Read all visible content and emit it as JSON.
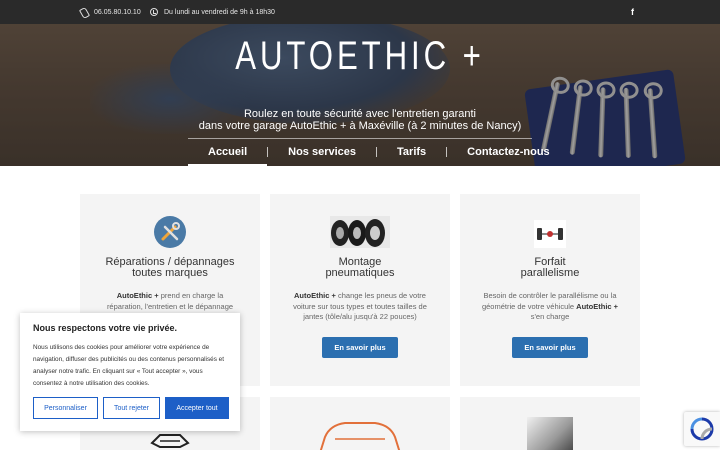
{
  "topbar": {
    "phone": "06.05.80.10.10",
    "hours": "Du lundi au vendredi de 9h à 18h30",
    "facebook": "f"
  },
  "hero": {
    "title": "AUTOETHIC +",
    "subtitle_line1": "Roulez en toute sécurité avec l'entretien garanti",
    "subtitle_line2": "dans votre garage AutoEthic + à Maxéville (à 2 minutes de Nancy)"
  },
  "nav": [
    {
      "label": "Accueil",
      "active": true
    },
    {
      "label": "Nos services"
    },
    {
      "label": "Tarifs"
    },
    {
      "label": "Contactez-nous"
    }
  ],
  "cards": [
    {
      "title_line1": "Réparations / dépannages",
      "title_line2": "toutes marques",
      "brand": "AutoEthic +",
      "desc_after": " prend en charge la réparation, l'entretien et le dépannage",
      "icon": "tools-icon"
    },
    {
      "title_line1": "Montage",
      "title_line2": "pneumatiques",
      "brand": "AutoEthic +",
      "desc_after": " change les pneus de votre voiture sur tous types et toutes tailles de jantes (tôle/alu jusqu'à 22 pouces)",
      "button": "En savoir plus",
      "icon": "tires-icon"
    },
    {
      "title_line1": "Forfait",
      "title_line2": "parallelisme",
      "desc_before": "Besoin de contrôler le parallélisme ou la géométrie de votre véhicule ",
      "brand": "AutoEthic +",
      "desc_after": " s'en charge",
      "button": "En savoir plus",
      "icon": "alignment-icon"
    }
  ],
  "cookie": {
    "heading": "Nous respectons votre vie privée.",
    "text": "Nous utilisons des cookies pour améliorer votre expérience de navigation, diffuser des publicités ou des contenus personnalisés et analyser notre trafic. En cliquant sur « Tout accepter », vous consentez à notre utilisation des cookies.",
    "customize": "Personnaliser",
    "reject": "Tout rejeter",
    "accept": "Accepter tout"
  },
  "colors": {
    "topbar": "#2a2a2a",
    "button": "#2b6fb0",
    "cookie_accent": "#1d5fc7",
    "card_bg": "#f4f4f4"
  }
}
